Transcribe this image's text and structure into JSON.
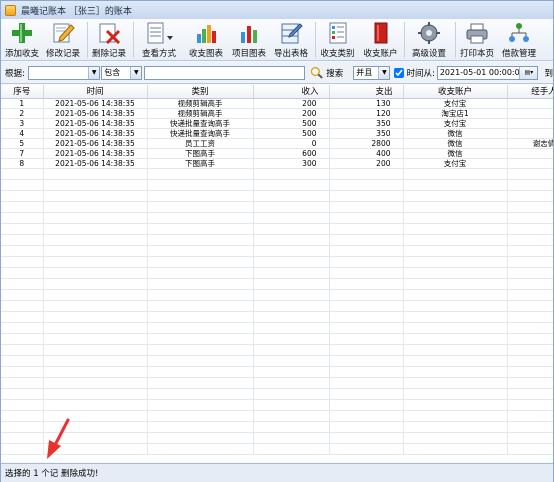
{
  "window": {
    "title": "晨曦记账本 ［张三］的账本"
  },
  "toolbar": {
    "items": [
      {
        "label": "添加收支",
        "icon": "add-plus-icon"
      },
      {
        "label": "修改记录",
        "icon": "edit-pencil-icon"
      },
      {
        "label": "删除记录",
        "icon": "delete-x-icon"
      },
      {
        "label": "查看方式",
        "icon": "view-document-icon"
      },
      {
        "label": "收支图表",
        "icon": "bar-chart-icon"
      },
      {
        "label": "项目图表",
        "icon": "pie-chart-icon"
      },
      {
        "label": "导出表格",
        "icon": "export-table-icon"
      },
      {
        "label": "收支类别",
        "icon": "category-list-icon"
      },
      {
        "label": "收支账户",
        "icon": "account-book-icon"
      },
      {
        "label": "高级设置",
        "icon": "gear-icon"
      },
      {
        "label": "打印本页",
        "icon": "printer-icon"
      },
      {
        "label": "借款管理",
        "icon": "network-people-icon"
      }
    ]
  },
  "filter": {
    "basis_label": "根据:",
    "basis_value": "",
    "match_value": "包含",
    "keyword_value": "",
    "search_label": "搜索",
    "logic_value": "并且",
    "time_from_label": "时间从:",
    "time_from_value": "2021-05-01 00:00:00",
    "time_to_label": "到"
  },
  "table": {
    "columns": [
      "序号",
      "时间",
      "类别",
      "收入",
      "支出",
      "收支账户",
      "经手人"
    ],
    "rows": [
      {
        "no": "1",
        "time": "2021-05-06 14:38:35",
        "category": "视频剪辑高手",
        "income": "200",
        "expense": "130",
        "account": "支付宝",
        "handler": ""
      },
      {
        "no": "2",
        "time": "2021-05-06 14:38:35",
        "category": "视频剪辑高手",
        "income": "200",
        "expense": "120",
        "account": "淘宝店1",
        "handler": ""
      },
      {
        "no": "3",
        "time": "2021-05-06 14:38:35",
        "category": "快递批量查询高手",
        "income": "500",
        "expense": "350",
        "account": "支付宝",
        "handler": ""
      },
      {
        "no": "4",
        "time": "2021-05-06 14:38:35",
        "category": "快递批量查询高手",
        "income": "500",
        "expense": "350",
        "account": "微信",
        "handler": ""
      },
      {
        "no": "5",
        "time": "2021-05-06 14:38:35",
        "category": "员工工资",
        "income": "0",
        "expense": "2800",
        "account": "微信",
        "handler": "谢志倩"
      },
      {
        "no": "7",
        "time": "2021-05-06 14:38:35",
        "category": "下图高手",
        "income": "600",
        "expense": "400",
        "account": "微信",
        "handler": ""
      },
      {
        "no": "8",
        "time": "2021-05-06 14:38:35",
        "category": "下图高手",
        "income": "300",
        "expense": "200",
        "account": "支付宝",
        "handler": ""
      }
    ]
  },
  "status": {
    "text": "选择的 1 个记 删除成功!"
  },
  "colors": {
    "annotation_arrow": "#e8322d"
  }
}
